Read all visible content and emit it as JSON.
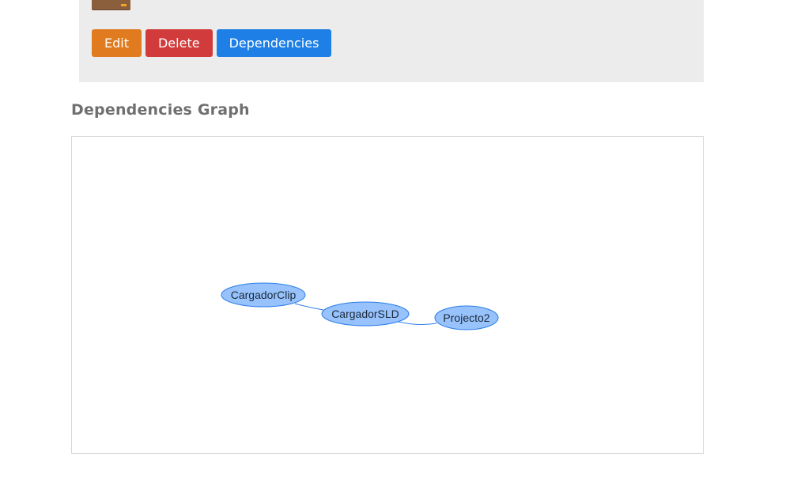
{
  "actions": {
    "edit_label": "Edit",
    "delete_label": "Delete",
    "dependencies_label": "Dependencies"
  },
  "graph": {
    "title": "Dependencies Graph",
    "nodes": [
      {
        "id": "clip",
        "label": "CargadorClip"
      },
      {
        "id": "sld",
        "label": "CargadorSLD"
      },
      {
        "id": "p2",
        "label": "Projecto2"
      }
    ],
    "edges": [
      {
        "from": "clip",
        "to": "sld"
      },
      {
        "from": "sld",
        "to": "p2"
      }
    ],
    "colors": {
      "node_fill": "#97c2fc",
      "node_stroke": "#2b7ce9",
      "edge": "#2b7ce9"
    }
  },
  "colors": {
    "edit": "#e07b1f",
    "delete": "#d23b3b",
    "dependencies": "#1e80e6",
    "panel_bg": "#ececec"
  }
}
